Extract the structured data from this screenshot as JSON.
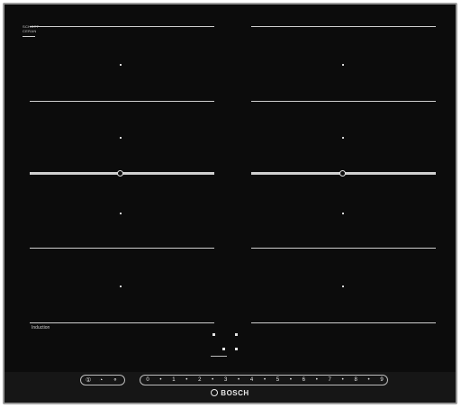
{
  "logo": {
    "line1": "SCHOTT",
    "line2": "CERAN"
  },
  "induction_label": "Induction",
  "controls": {
    "items": [
      {
        "name": "power-icon",
        "glyph": "①"
      },
      {
        "name": "timer-icon",
        "glyph": "◔"
      },
      {
        "name": "wipe-protection-icon",
        "glyph": "⚬"
      }
    ]
  },
  "power_slider": {
    "labels": [
      "0",
      "•",
      "1",
      "•",
      "2",
      "•",
      "3",
      "•",
      "4",
      "•",
      "5",
      "•",
      "6",
      "•",
      "7",
      "•",
      "8",
      "•",
      "9"
    ]
  },
  "brand": {
    "name": "BOSCH"
  },
  "colors": {
    "glass": "#0c0c0c",
    "frame": "#9a9a9a",
    "markings": "#cfcfcf"
  }
}
